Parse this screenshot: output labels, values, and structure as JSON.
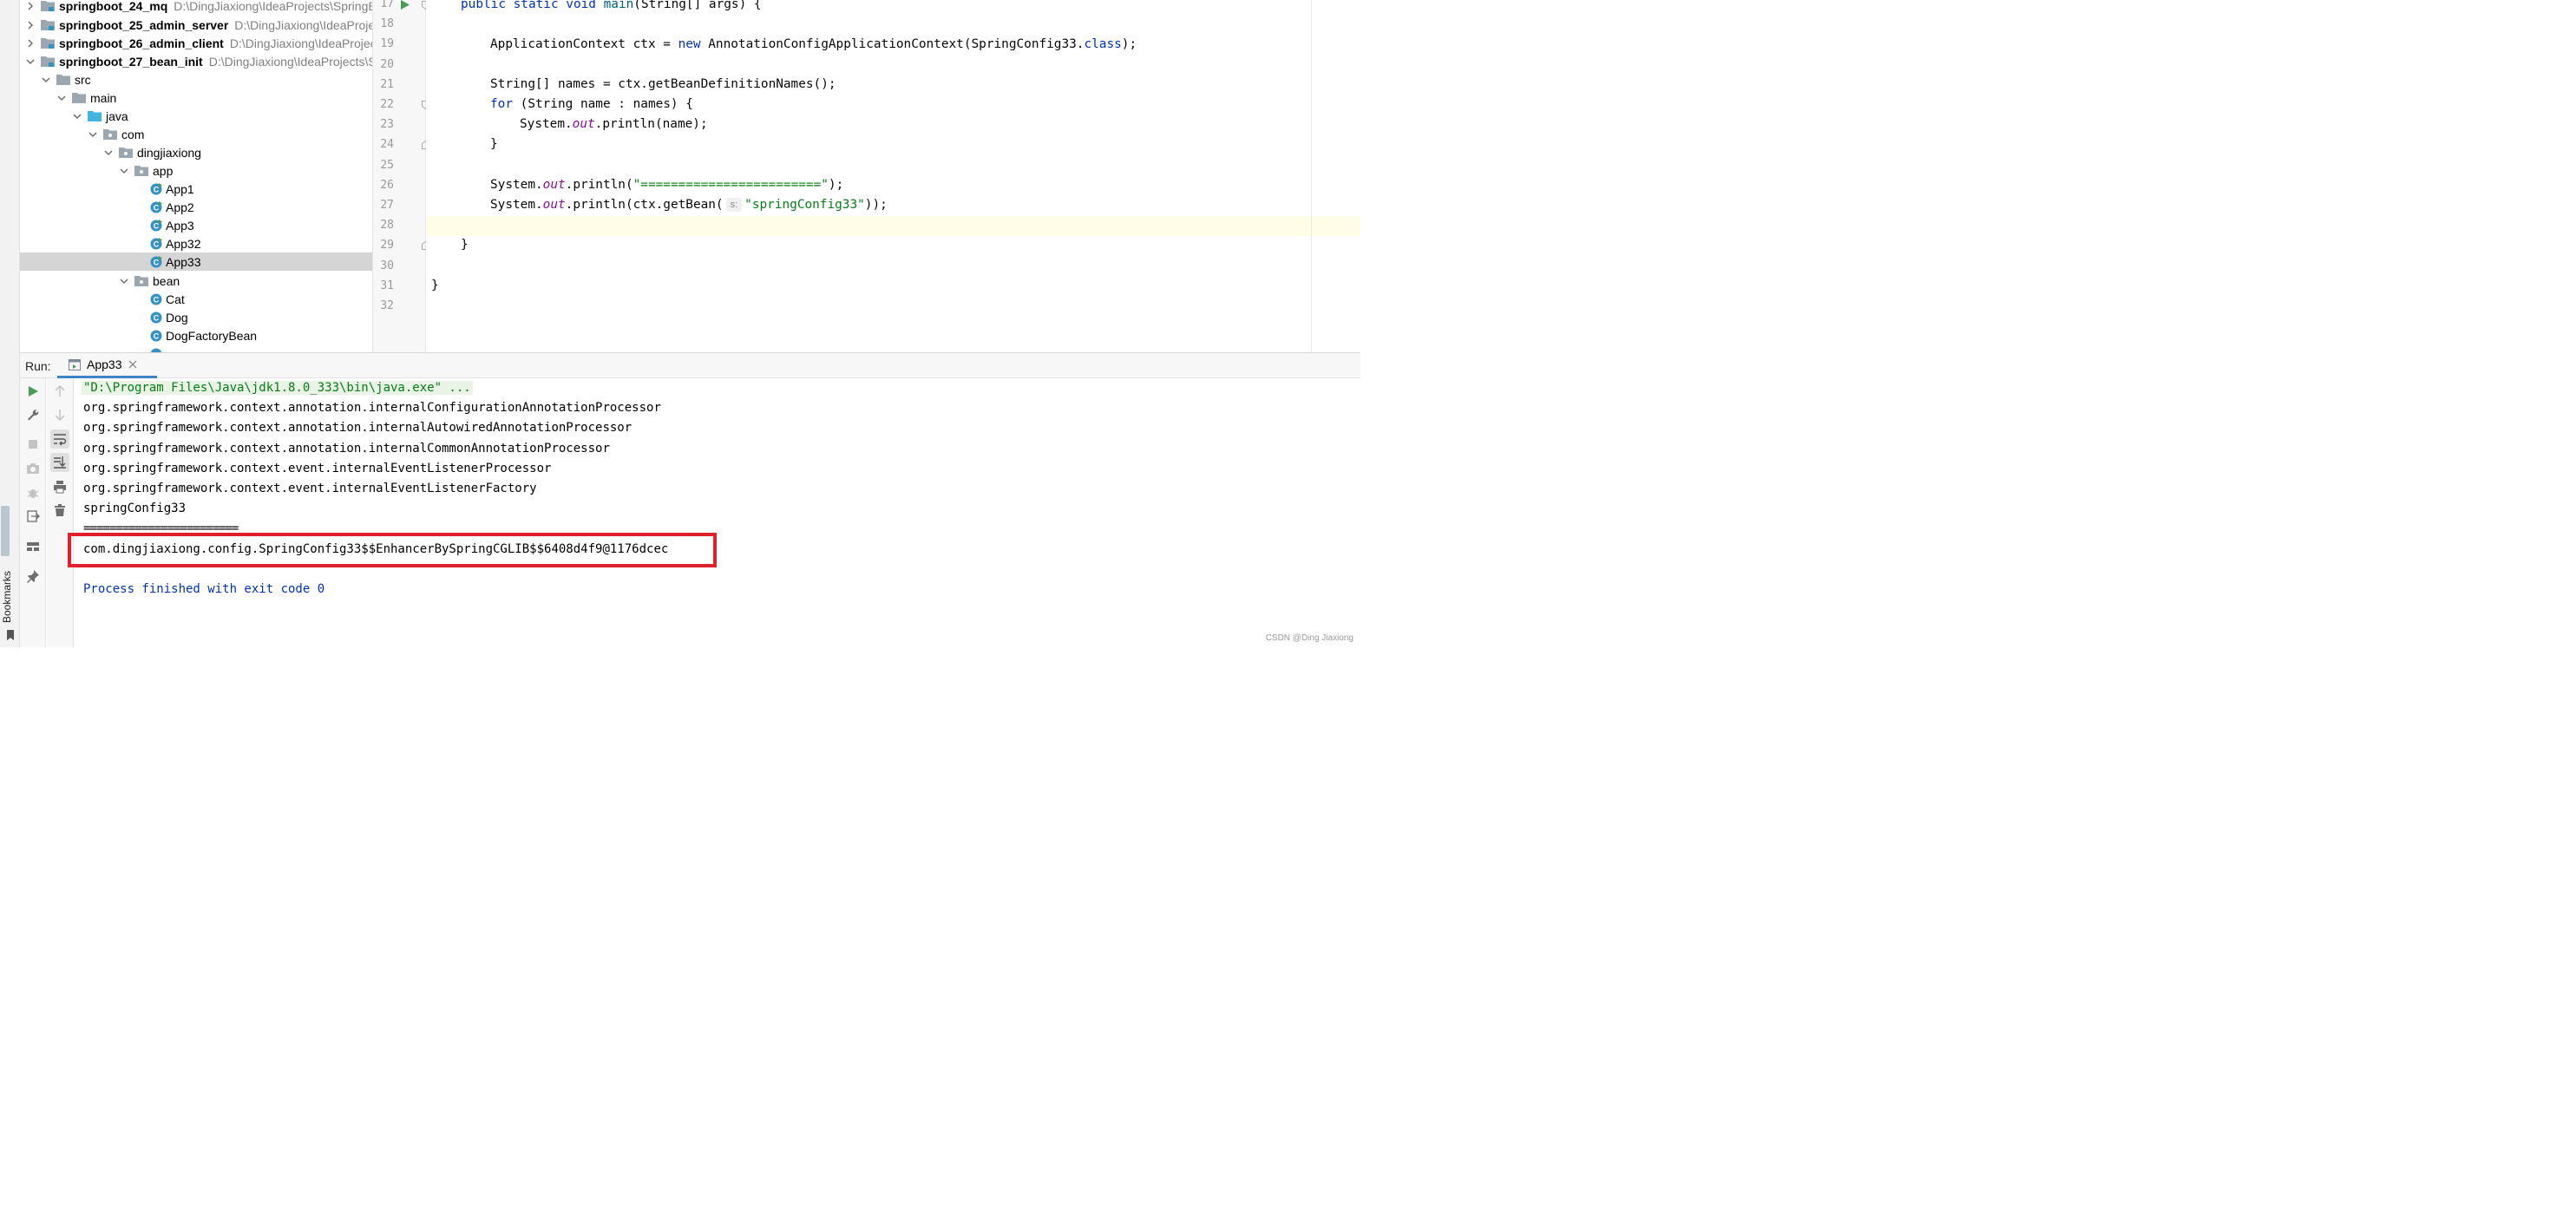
{
  "bookmarks": {
    "label": "Bookmarks"
  },
  "project_tree": {
    "modules": [
      {
        "name": "springboot_24_mq",
        "path": "D:\\DingJiaxiong\\IdeaProjects\\SpringBo"
      },
      {
        "name": "springboot_25_admin_server",
        "path": "D:\\DingJiaxiong\\IdeaProject"
      },
      {
        "name": "springboot_26_admin_client",
        "path": "D:\\DingJiaxiong\\IdeaProjects"
      },
      {
        "name": "springboot_27_bean_init",
        "path": "D:\\DingJiaxiong\\IdeaProjects\\Spr"
      }
    ],
    "nodes": {
      "src": "src",
      "main": "main",
      "java": "java",
      "com": "com",
      "pkg": "dingjiaxiong",
      "app": "app",
      "app_classes": [
        "App1",
        "App2",
        "App3",
        "App32",
        "App33"
      ],
      "bean": "bean",
      "bean_classes": [
        "Cat",
        "Dog",
        "DogFactoryBean"
      ]
    },
    "selected": "App33"
  },
  "editor": {
    "line_numbers": [
      "17",
      "18",
      "19",
      "20",
      "21",
      "22",
      "23",
      "24",
      "25",
      "26",
      "27",
      "28",
      "29",
      "30",
      "31",
      "32"
    ],
    "line17": {
      "kw": "public static void ",
      "fn": "main",
      "rest": "(String[] args) {"
    },
    "line19": {
      "a": "ApplicationContext ctx = ",
      "kw": "new ",
      "b": "AnnotationConfigApplicationContext(SpringConfig33.",
      "kw2": "class",
      "c": ");"
    },
    "line21": "String[] names = ctx.getBeanDefinitionNames();",
    "line22": {
      "kw": "for ",
      "rest": "(String name : names) {"
    },
    "line23": {
      "a": "System.",
      "fld": "out",
      "b": ".println(name);"
    },
    "line24": "}",
    "line26": {
      "a": "System.",
      "fld": "out",
      "b": ".println(",
      "str": "\"========================\"",
      "c": ");"
    },
    "line27": {
      "a": "System.",
      "fld": "out",
      "b": ".println(ctx.getBean(",
      "hint": "s:",
      "str": "\"springConfig33\"",
      "c": "));"
    },
    "line29": "}",
    "line31": "}"
  },
  "run_panel": {
    "label": "Run:",
    "tab": "App33"
  },
  "console": {
    "command": "\"D:\\Program Files\\Java\\jdk1.8.0_333\\bin\\java.exe\" ...",
    "lines": [
      "org.springframework.context.annotation.internalConfigurationAnnotationProcessor",
      "org.springframework.context.annotation.internalAutowiredAnnotationProcessor",
      "org.springframework.context.annotation.internalCommonAnnotationProcessor",
      "org.springframework.context.event.internalEventListenerProcessor",
      "org.springframework.context.event.internalEventListenerFactory",
      "springConfig33",
      "========================",
      "com.dingjiaxiong.config.SpringConfig33$$EnhancerBySpringCGLIB$$6408d4f9@1176dcec"
    ],
    "exit": "Process finished with exit code 0"
  },
  "colors": {
    "highlight_box": "#e0202a",
    "keyword": "#0033b3",
    "string": "#067d17",
    "field": "#871094",
    "class_icon": "#3592c4",
    "run_green": "#499c54"
  },
  "watermark": "CSDN @Ding Jiaxiong"
}
